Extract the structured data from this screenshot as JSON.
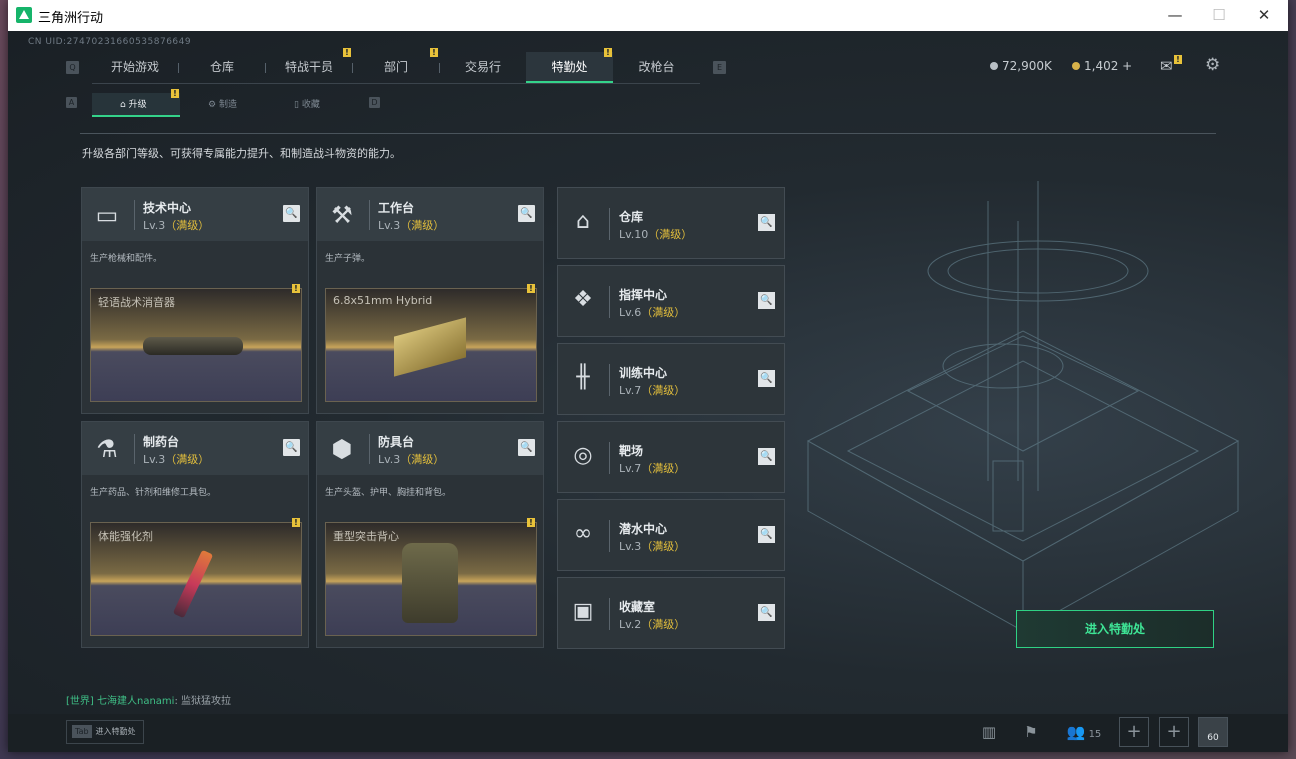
{
  "window": {
    "title": "三角洲行动",
    "minimize": "—",
    "maximize": "☐",
    "close": "✕"
  },
  "uid": "CN UID:274702316605358766​49",
  "nav": {
    "key_left": "Q",
    "key_right": "E",
    "tabs": [
      "开始游戏",
      "仓库",
      "特战干员",
      "部门",
      "交易行",
      "特勤处",
      "改枪台"
    ],
    "active": "特勤处"
  },
  "currency": {
    "silver": "72,900K",
    "gold": "1,402 +"
  },
  "subnav": {
    "key_left": "A",
    "key_right": "D",
    "tabs": [
      "升级",
      "制造",
      "收藏"
    ],
    "active": "升级"
  },
  "description": "升级各部门等级、可获得专属能力提升、和制造战斗物资的能力。",
  "facilities": [
    {
      "name": "技术中心",
      "level": "Lv.3",
      "max": "（满级）",
      "desc": "生产枪械和配件。",
      "item": "轻语战术消音器",
      "icon": "monitor-icon"
    },
    {
      "name": "工作台",
      "level": "Lv.3",
      "max": "（满级）",
      "desc": "生产子弹。",
      "item": "6.8x51mm Hybrid",
      "icon": "tools-icon"
    },
    {
      "name": "制药台",
      "level": "Lv.3",
      "max": "（满级）",
      "desc": "生产药品、针剂和维修工具包。",
      "item": "体能强化剂",
      "icon": "microscope-icon"
    },
    {
      "name": "防具台",
      "level": "Lv.3",
      "max": "（满级）",
      "desc": "生产头盔、护甲、胸挂和背包。",
      "item": "重型突击背心",
      "icon": "cubes-icon"
    }
  ],
  "side_facilities": [
    {
      "name": "仓库",
      "level": "Lv.10",
      "max": "（满级）",
      "icon": "warehouse-icon"
    },
    {
      "name": "指挥中心",
      "level": "Lv.6",
      "max": "（满级）",
      "icon": "command-icon"
    },
    {
      "name": "训练中心",
      "level": "Lv.7",
      "max": "（满级）",
      "icon": "dumbbell-icon"
    },
    {
      "name": "靶场",
      "level": "Lv.7",
      "max": "（满级）",
      "icon": "target-icon"
    },
    {
      "name": "潜水中心",
      "level": "Lv.3",
      "max": "（满级）",
      "icon": "goggles-icon"
    },
    {
      "name": "收藏室",
      "level": "Lv.2",
      "max": "（满级）",
      "icon": "collection-icon"
    }
  ],
  "enter_button": "进入特勤处",
  "chat": {
    "channel": "[世界]",
    "user": "七海建人nanami",
    "message": "监狱猛攻拉"
  },
  "bottom": {
    "tab_key": "Tab",
    "tab_label": "进入特勤处",
    "friends": "15",
    "avatar_level": "60"
  },
  "colors": {
    "accent": "#34d38a",
    "max_level": "#e2be3c",
    "badge": "#e8c23a"
  }
}
